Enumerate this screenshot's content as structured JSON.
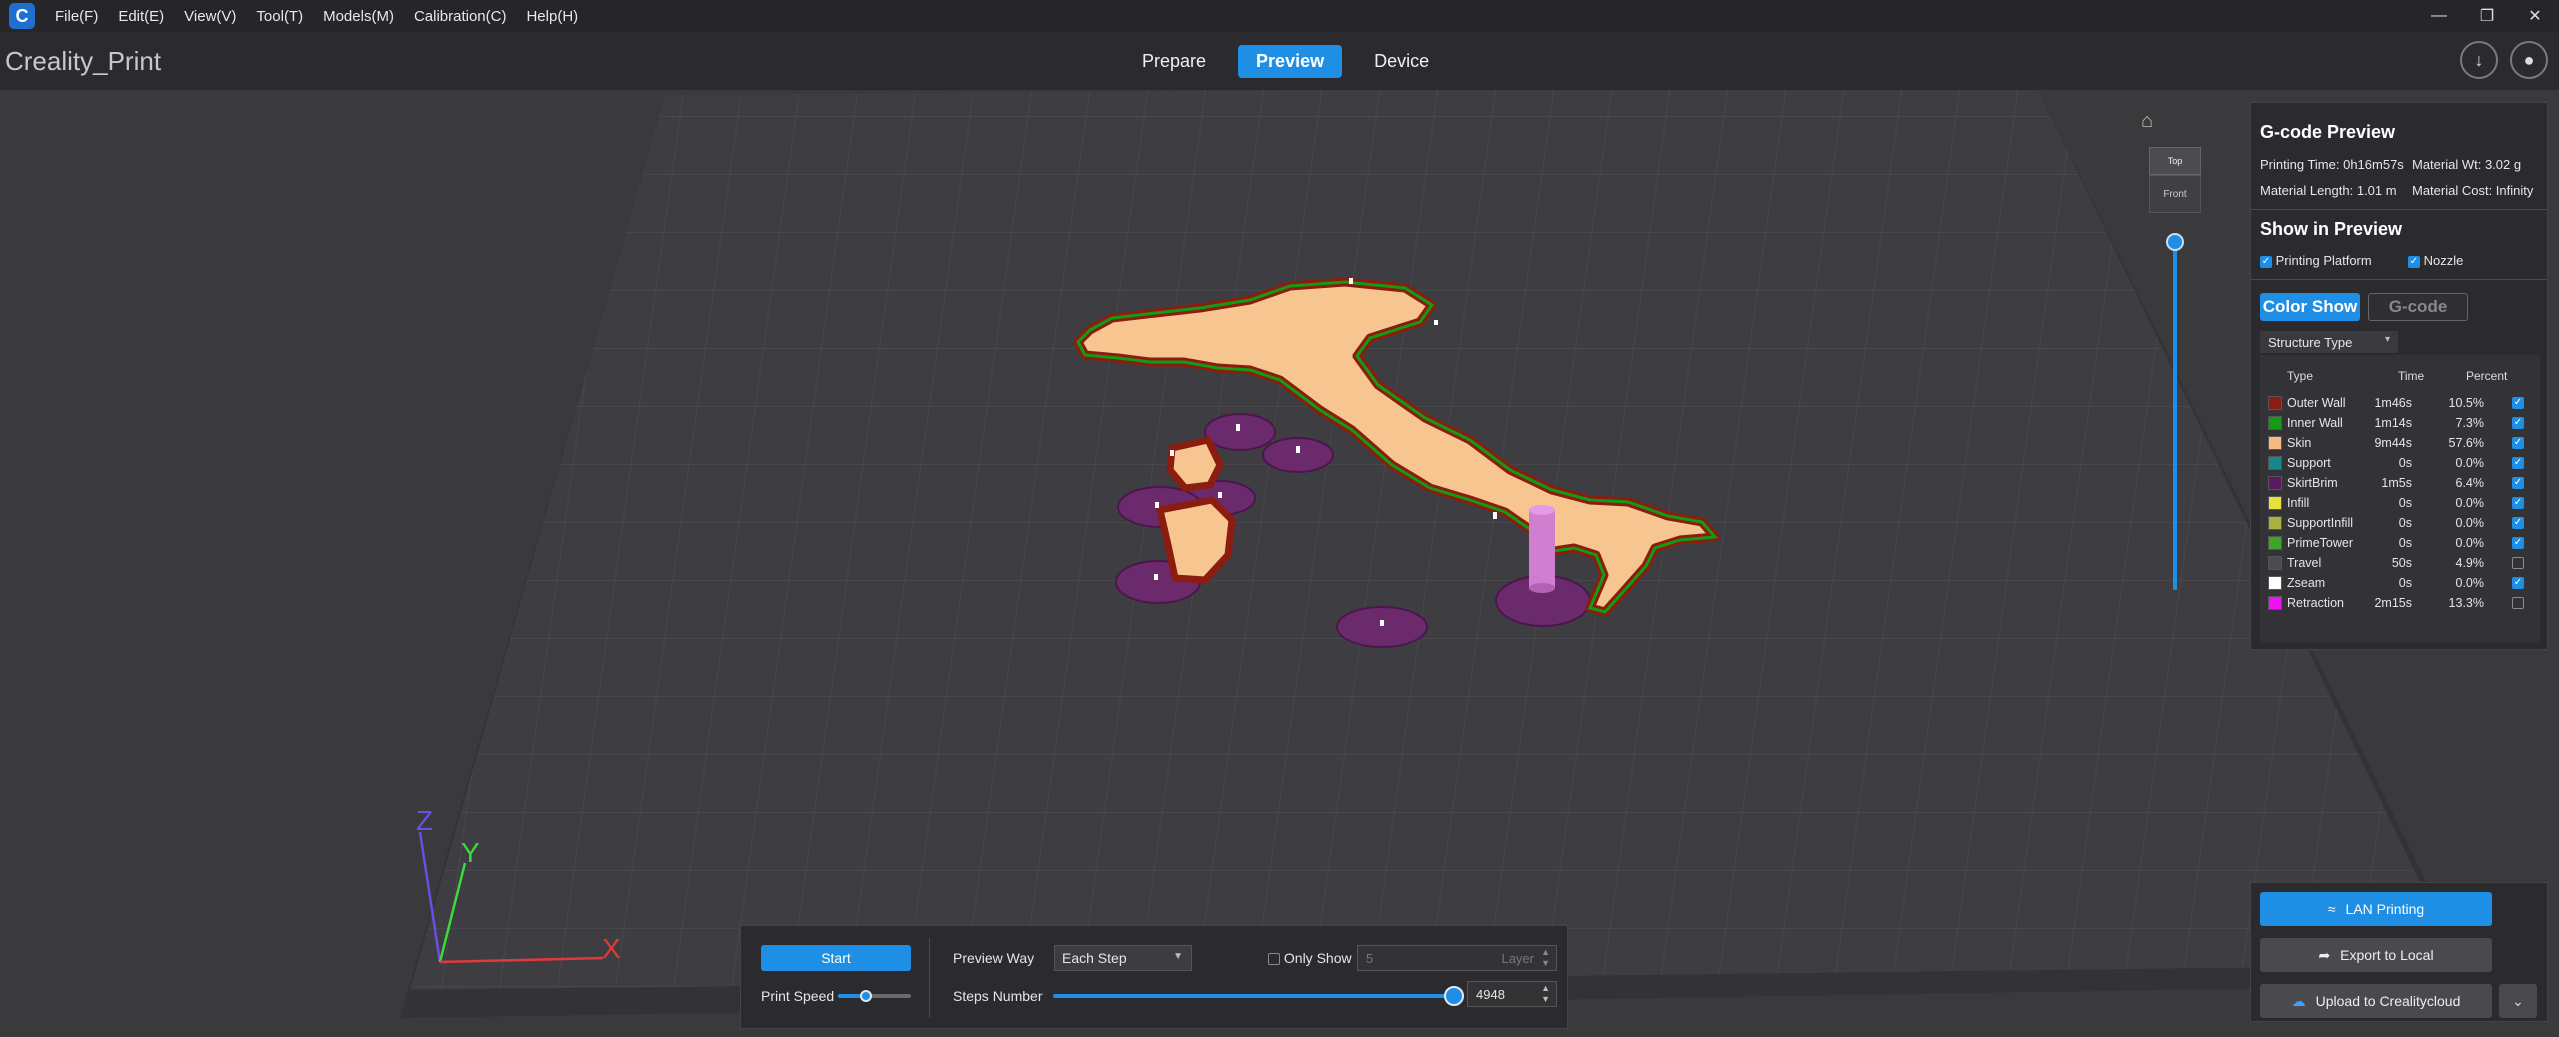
{
  "menu": {
    "items": [
      "File(F)",
      "Edit(E)",
      "View(V)",
      "Tool(T)",
      "Models(M)",
      "Calibration(C)",
      "Help(H)"
    ]
  },
  "header": {
    "app_title": "Creality_Print",
    "tabs": [
      {
        "label": "Prepare",
        "active": false
      },
      {
        "label": "Preview",
        "active": true
      },
      {
        "label": "Device",
        "active": false
      }
    ]
  },
  "viewport": {
    "view_cube": {
      "top": "Top",
      "front": "Front"
    },
    "axes": {
      "x": "X",
      "y": "Y",
      "z": "Z"
    }
  },
  "gcode_preview": {
    "title": "G-code Preview",
    "printing_time": "Printing Time: 0h16m57s",
    "material_wt": "Material Wt: 3.02 g",
    "material_length": "Material Length: 1.01 m",
    "material_cost": "Material Cost: Infinity",
    "show_title": "Show in Preview",
    "printing_platform": "Printing Platform",
    "nozzle": "Nozzle",
    "color_show": "Color Show",
    "gcode_tab": "G-code",
    "structure_tab": "Structure Type",
    "headers": {
      "type": "Type",
      "time": "Time",
      "percent": "Percent"
    },
    "rows": [
      {
        "name": "Outer Wall",
        "time": "1m46s",
        "percent": "10.5%",
        "color": "#8a1c10",
        "checked": true
      },
      {
        "name": "Inner Wall",
        "time": "1m14s",
        "percent": "7.3%",
        "color": "#139b13",
        "checked": true
      },
      {
        "name": "Skin",
        "time": "9m44s",
        "percent": "57.6%",
        "color": "#f6ba85",
        "checked": true
      },
      {
        "name": "Support",
        "time": "0s",
        "percent": "0.0%",
        "color": "#17878a",
        "checked": true
      },
      {
        "name": "SkirtBrim",
        "time": "1m5s",
        "percent": "6.4%",
        "color": "#5c1a5e",
        "checked": true
      },
      {
        "name": "Infill",
        "time": "0s",
        "percent": "0.0%",
        "color": "#e5e23d",
        "checked": true
      },
      {
        "name": "SupportInfill",
        "time": "0s",
        "percent": "0.0%",
        "color": "#a9b23a",
        "checked": true
      },
      {
        "name": "PrimeTower",
        "time": "0s",
        "percent": "0.0%",
        "color": "#3da62a",
        "checked": true
      },
      {
        "name": "Travel",
        "time": "50s",
        "percent": "4.9%",
        "color": "#4a4a50",
        "checked": false
      },
      {
        "name": "Zseam",
        "time": "0s",
        "percent": "0.0%",
        "color": "#ffffff",
        "checked": true
      },
      {
        "name": "Retraction",
        "time": "2m15s",
        "percent": "13.3%",
        "color": "#f012f0",
        "checked": false
      }
    ]
  },
  "playback": {
    "start_label": "Start",
    "print_speed_label": "Print Speed",
    "preview_way_label": "Preview Way",
    "preview_way_value": "Each Step",
    "only_show_label": "Only Show",
    "layer_value": "5",
    "layer_unit": "Layer",
    "steps_label": "Steps Number",
    "steps_value": "4948"
  },
  "export": {
    "lan": "LAN Printing",
    "export_local": "Export to Local",
    "upload": "Upload to Crealitycloud"
  }
}
